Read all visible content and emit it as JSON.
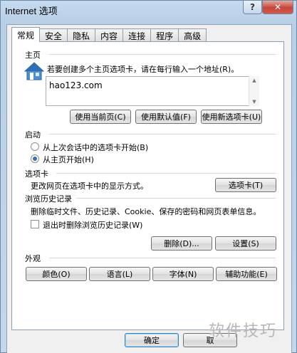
{
  "window": {
    "title": "Internet 选项",
    "help_label": "?",
    "close_label": "✕"
  },
  "tabs": [
    {
      "label": "常规"
    },
    {
      "label": "安全"
    },
    {
      "label": "隐私"
    },
    {
      "label": "内容"
    },
    {
      "label": "连接"
    },
    {
      "label": "程序"
    },
    {
      "label": "高级"
    }
  ],
  "home": {
    "section_label": "主页",
    "description": "若要创建多个主页选项卡，请在每行输入一个地址(R)。",
    "url_value": "hao123.com",
    "icon": "house-icon",
    "buttons": {
      "use_current": "使用当前页(C)",
      "use_default": "使用默认值(F)",
      "use_new_tab": "使用新选项卡(U)"
    }
  },
  "startup": {
    "section_label": "启动",
    "option_last_session": "从上次会话中的选项卡开始(B)",
    "option_home": "从主页开始(H)",
    "selected": "option_home"
  },
  "tabs_section": {
    "section_label": "选项卡",
    "description": "更改网页在选项卡中的显示方式。",
    "button": "选项卡(T)"
  },
  "history": {
    "section_label": "浏览历史记录",
    "description": "删除临时文件、历史记录、Cookie、保存的密码和网页表单信息。",
    "checkbox_label": "退出时删除浏览历史记录(W)",
    "checked": false,
    "delete_button": "删除(D)...",
    "settings_button": "设置(S)"
  },
  "appearance": {
    "section_label": "外观",
    "colors_button": "颜色(O)",
    "languages_button": "语言(L)",
    "fonts_button": "字体(N)",
    "accessibility_button": "辅助功能(E)"
  },
  "footer": {
    "ok_button": "确定",
    "cancel_button": "取"
  },
  "watermark": "软件技巧"
}
